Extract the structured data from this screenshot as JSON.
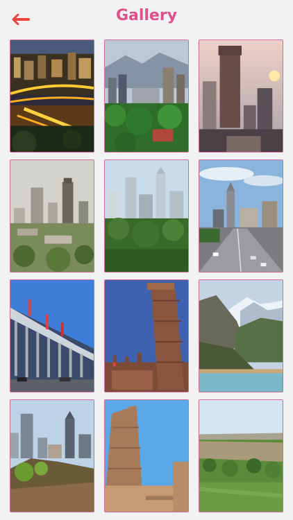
{
  "header": {
    "title": "Gallery",
    "back_icon": "back-arrow-icon",
    "accent_color": "#e0508a",
    "back_color": "#e8453c"
  },
  "gallery": {
    "border_color": "#d36a9b",
    "photos": [
      {
        "scene": "city-night-highway"
      },
      {
        "scene": "city-mountains-park"
      },
      {
        "scene": "tower-sunset"
      },
      {
        "scene": "hazy-skyline"
      },
      {
        "scene": "skyline-trees"
      },
      {
        "scene": "highway-skyline"
      },
      {
        "scene": "exhibition-hall"
      },
      {
        "scene": "minaret-tower"
      },
      {
        "scene": "snowy-mountains-lake"
      },
      {
        "scene": "towers-rocky-hill"
      },
      {
        "scene": "brick-minaret"
      },
      {
        "scene": "green-valley-cliff"
      }
    ]
  }
}
